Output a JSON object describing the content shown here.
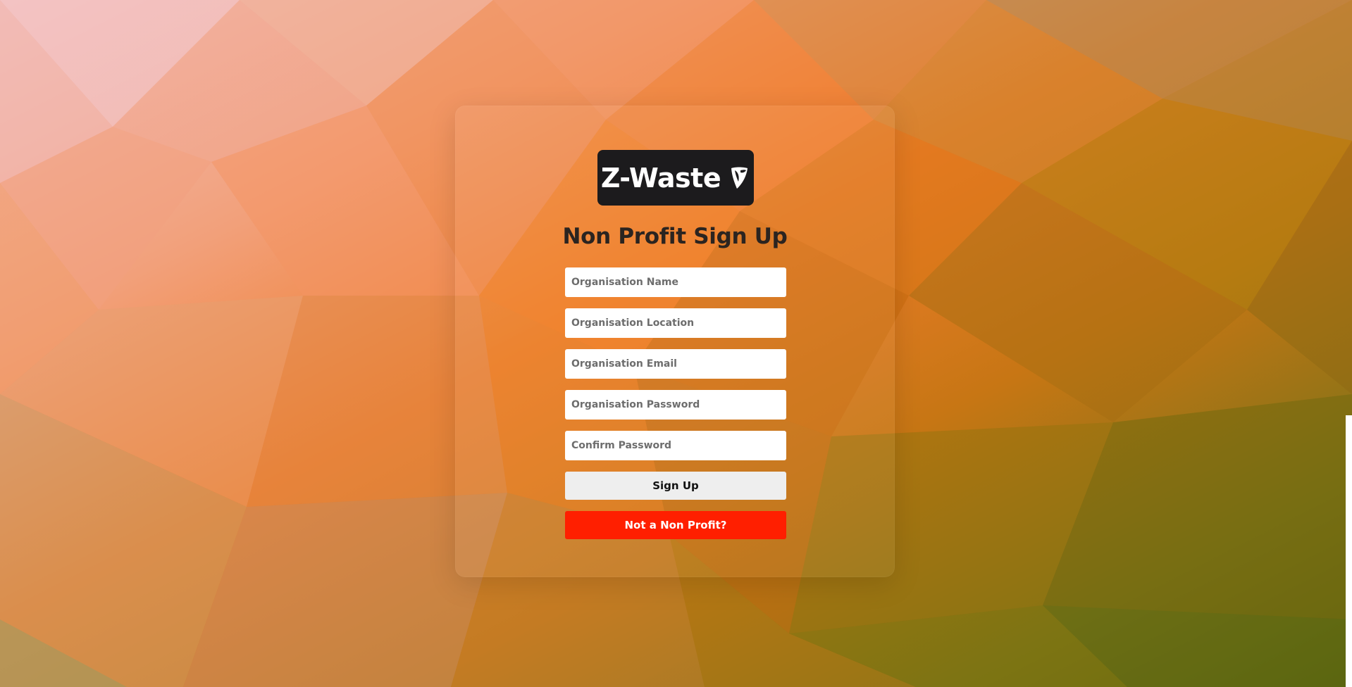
{
  "brand": {
    "name": "Z-Waste",
    "icon": "shield-leaf-icon"
  },
  "form": {
    "title": "Non Profit Sign Up",
    "fields": [
      {
        "placeholder": "Organisation Name",
        "value": ""
      },
      {
        "placeholder": "Organisation Location",
        "value": ""
      },
      {
        "placeholder": "Organisation Email",
        "value": ""
      },
      {
        "placeholder": "Organisation Password",
        "value": ""
      },
      {
        "placeholder": "Confirm Password",
        "value": ""
      }
    ],
    "signup_label": "Sign Up",
    "not_nonprofit_label": "Not a Non Profit?"
  },
  "colors": {
    "accent_red": "#ff1f00",
    "logo_bg": "#1c1b1d",
    "signup_bg": "#eeeeee",
    "background_warm": "#f08a40",
    "background_olive": "#6b6a1a"
  }
}
